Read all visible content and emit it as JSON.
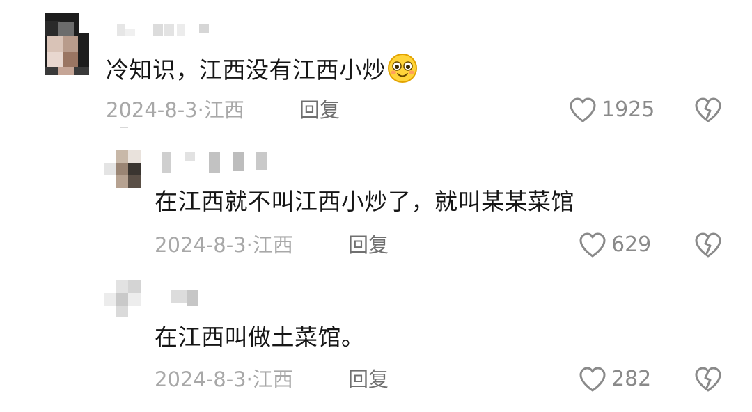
{
  "comments": [
    {
      "text": "冷知识，江西没有江西小炒",
      "emoji": "smiling-face-emoji",
      "date": "2024-8-3",
      "location": "江西",
      "reply_label": "回复",
      "likes": "1925"
    },
    {
      "text": "在江西就不叫江西小炒了，就叫某某菜馆",
      "date": "2024-8-3",
      "location": "江西",
      "reply_label": "回复",
      "likes": "629"
    },
    {
      "text": "在江西叫做土菜馆。",
      "date": "2024-8-3",
      "location": "江西",
      "reply_label": "回复",
      "likes": "282"
    }
  ],
  "icons": {
    "like": "heart-outline-icon",
    "dislike": "broken-heart-icon"
  },
  "colors": {
    "text": "#161616",
    "meta": "#a8a8a8",
    "reply": "#707070",
    "icon": "#8a8a8a"
  },
  "meta_separator": "·"
}
